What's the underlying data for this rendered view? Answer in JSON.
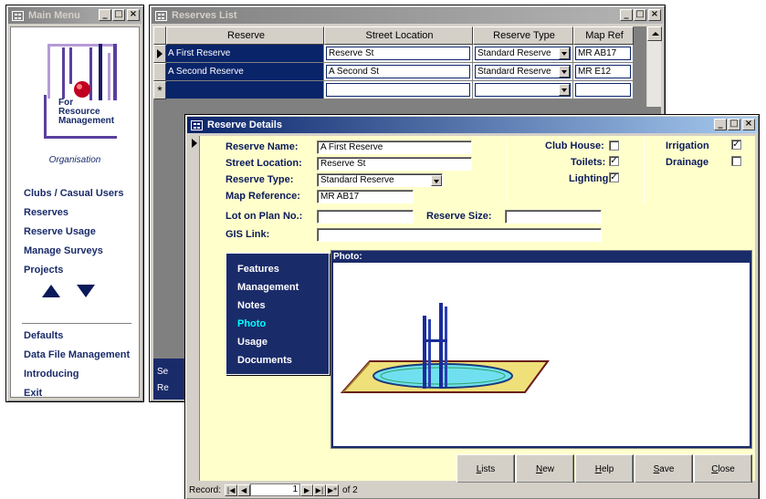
{
  "main_menu": {
    "title": "Main Menu",
    "logo_text": [
      "For",
      "Resource",
      "Management"
    ],
    "organisation": "Organisation",
    "items": [
      "Clubs / Casual Users",
      "Reserves",
      "Reserve Usage",
      "Manage Surveys",
      "Projects"
    ],
    "items2": [
      "Defaults",
      "Data File Management",
      "Introducing",
      "Exit"
    ]
  },
  "reserves_list": {
    "title": "Reserves List",
    "columns": [
      "Reserve",
      "Street Location",
      "Reserve Type",
      "Map Ref"
    ],
    "rows": [
      {
        "reserve": "A First Reserve",
        "street": "Reserve St",
        "type": "Standard Reserve",
        "map": "MR AB17"
      },
      {
        "reserve": "A Second Reserve",
        "street": "A Second St",
        "type": "Standard Reserve",
        "map": "MR E12"
      }
    ],
    "new_row_marker": "*",
    "footer_lines": [
      "Se",
      "Re"
    ]
  },
  "reserve_details": {
    "title": "Reserve Details",
    "labels": {
      "reserve_name": "Reserve Name:",
      "street_location": "Street Location:",
      "reserve_type": "Reserve Type:",
      "map_reference": "Map Reference:",
      "lot_on_plan": "Lot on Plan No.:",
      "reserve_size": "Reserve Size:",
      "gis_link": "GIS Link:",
      "club_house": "Club House:",
      "toilets": "Toilets:",
      "lighting": "Lighting",
      "irrigation": "Irrigation",
      "drainage": "Drainage"
    },
    "values": {
      "reserve_name": "A First Reserve",
      "street_location": "Reserve St",
      "reserve_type": "Standard Reserve",
      "map_reference": "MR AB17",
      "lot_on_plan": "",
      "reserve_size": "",
      "gis_link": ""
    },
    "checks": {
      "club_house": false,
      "toilets": true,
      "lighting": true,
      "irrigation": true,
      "drainage": false
    },
    "tabs": [
      "Features",
      "Management",
      "Notes",
      "Photo",
      "Usage",
      "Documents"
    ],
    "active_tab": "Photo",
    "photo_label": "Photo:",
    "buttons": [
      {
        "key": "L",
        "rest": "ists"
      },
      {
        "key": "N",
        "rest": "ew"
      },
      {
        "key": "H",
        "rest": "elp"
      },
      {
        "key": "S",
        "rest": "ave"
      },
      {
        "key": "C",
        "rest": "lose"
      }
    ],
    "record_bar": {
      "label": "Record:",
      "current": "1",
      "of_text": "of 2"
    }
  },
  "colors": {
    "navy": "#1a2b6a",
    "form_bg": "#ffffcc",
    "active_tab": "#00ffff"
  }
}
